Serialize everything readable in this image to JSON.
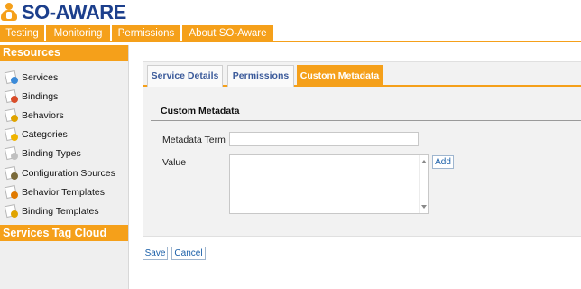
{
  "app": {
    "logo_text": "SO-AWARE"
  },
  "topnav": {
    "tabs": [
      {
        "label": "Testing"
      },
      {
        "label": "Monitoring"
      },
      {
        "label": "Permissions"
      },
      {
        "label": "About SO-Aware"
      }
    ]
  },
  "sidebar": {
    "resources_header": "Resources",
    "items": [
      {
        "label": "Services",
        "icon": "services-icon",
        "color": "#3b8ad8"
      },
      {
        "label": "Bindings",
        "icon": "bindings-icon",
        "color": "#d94d2a"
      },
      {
        "label": "Behaviors",
        "icon": "behaviors-icon",
        "color": "#e0a400"
      },
      {
        "label": "Categories",
        "icon": "categories-icon",
        "color": "#f0b400"
      },
      {
        "label": "Binding Types",
        "icon": "binding-types-icon",
        "color": "#c0c0c0"
      },
      {
        "label": "Configuration Sources",
        "icon": "configuration-sources-icon",
        "color": "#7a6a3a"
      },
      {
        "label": "Behavior Templates",
        "icon": "behavior-templates-icon",
        "color": "#e07a00"
      },
      {
        "label": "Binding Templates",
        "icon": "binding-templates-icon",
        "color": "#e0a400"
      }
    ],
    "tag_cloud_header": "Services Tag Cloud"
  },
  "main": {
    "tabs": [
      {
        "label": "Service Details",
        "active": false
      },
      {
        "label": "Permissions",
        "active": false
      },
      {
        "label": "Custom Metadata",
        "active": true
      }
    ],
    "section_title": "Custom Metadata",
    "fields": {
      "metadata_term_label": "Metadata Term",
      "metadata_term_value": "",
      "value_label": "Value",
      "value_value": ""
    },
    "add_button": "Add"
  },
  "footer_buttons": {
    "save": "Save",
    "cancel": "Cancel"
  },
  "colors": {
    "accent": "#f5a01a",
    "logo": "#1c3f8c",
    "link": "#3b5a9a"
  }
}
